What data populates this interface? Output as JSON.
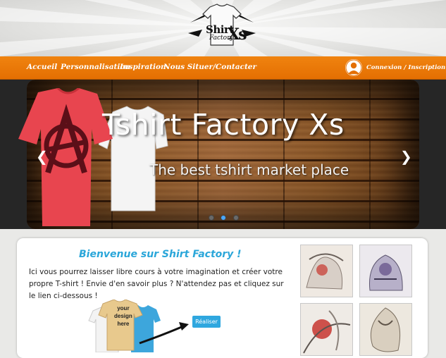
{
  "header": {
    "logo": {
      "line1": "Shirt",
      "line2": "Factory",
      "line3": "Xs"
    }
  },
  "nav": {
    "items": [
      "Accueil",
      "Personnalisation",
      "Inspiration",
      "Nous Situer/Contacter"
    ],
    "login_label": "Connexion / Inscription"
  },
  "carousel": {
    "title": "Tshirt Factory Xs",
    "subtitle": "The best tshirt market place",
    "prev_icon": "chevron-left-icon",
    "next_icon": "chevron-right-icon",
    "slides_count": 3,
    "active_slide": 2
  },
  "welcome": {
    "title": "Bienvenue sur Shirt Factory !",
    "text": "Ici vous pourrez laisser libre cours à votre imagination et créer votre propre T-shirt ! Envie d'en savoir plus ? N'attendez pas et cliquez sur le lien ci-dessous !",
    "design_line1": "your",
    "design_line2": "design",
    "design_line3": "here",
    "button_label": "Réaliser"
  },
  "colors": {
    "nav_orange": "#ef7d0a",
    "accent_blue": "#2aa6d9",
    "shirt_red": "#e8454f"
  }
}
